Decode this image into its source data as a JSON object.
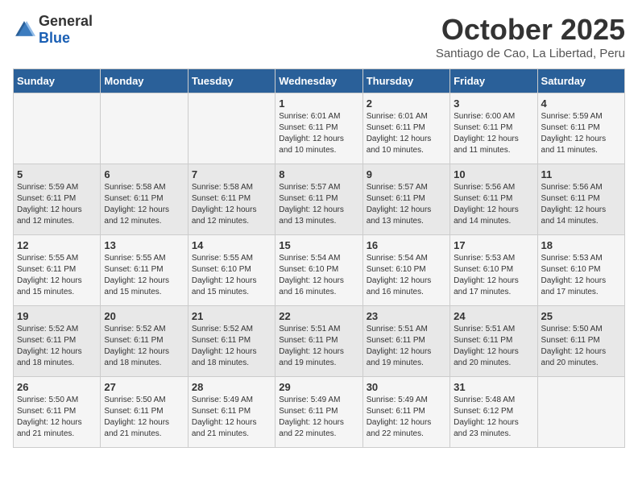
{
  "header": {
    "logo_general": "General",
    "logo_blue": "Blue",
    "month_title": "October 2025",
    "subtitle": "Santiago de Cao, La Libertad, Peru"
  },
  "weekdays": [
    "Sunday",
    "Monday",
    "Tuesday",
    "Wednesday",
    "Thursday",
    "Friday",
    "Saturday"
  ],
  "weeks": [
    [
      {
        "day": "",
        "sunrise": "",
        "sunset": "",
        "daylight": ""
      },
      {
        "day": "",
        "sunrise": "",
        "sunset": "",
        "daylight": ""
      },
      {
        "day": "",
        "sunrise": "",
        "sunset": "",
        "daylight": ""
      },
      {
        "day": "1",
        "sunrise": "Sunrise: 6:01 AM",
        "sunset": "Sunset: 6:11 PM",
        "daylight": "Daylight: 12 hours and 10 minutes."
      },
      {
        "day": "2",
        "sunrise": "Sunrise: 6:01 AM",
        "sunset": "Sunset: 6:11 PM",
        "daylight": "Daylight: 12 hours and 10 minutes."
      },
      {
        "day": "3",
        "sunrise": "Sunrise: 6:00 AM",
        "sunset": "Sunset: 6:11 PM",
        "daylight": "Daylight: 12 hours and 11 minutes."
      },
      {
        "day": "4",
        "sunrise": "Sunrise: 5:59 AM",
        "sunset": "Sunset: 6:11 PM",
        "daylight": "Daylight: 12 hours and 11 minutes."
      }
    ],
    [
      {
        "day": "5",
        "sunrise": "Sunrise: 5:59 AM",
        "sunset": "Sunset: 6:11 PM",
        "daylight": "Daylight: 12 hours and 12 minutes."
      },
      {
        "day": "6",
        "sunrise": "Sunrise: 5:58 AM",
        "sunset": "Sunset: 6:11 PM",
        "daylight": "Daylight: 12 hours and 12 minutes."
      },
      {
        "day": "7",
        "sunrise": "Sunrise: 5:58 AM",
        "sunset": "Sunset: 6:11 PM",
        "daylight": "Daylight: 12 hours and 12 minutes."
      },
      {
        "day": "8",
        "sunrise": "Sunrise: 5:57 AM",
        "sunset": "Sunset: 6:11 PM",
        "daylight": "Daylight: 12 hours and 13 minutes."
      },
      {
        "day": "9",
        "sunrise": "Sunrise: 5:57 AM",
        "sunset": "Sunset: 6:11 PM",
        "daylight": "Daylight: 12 hours and 13 minutes."
      },
      {
        "day": "10",
        "sunrise": "Sunrise: 5:56 AM",
        "sunset": "Sunset: 6:11 PM",
        "daylight": "Daylight: 12 hours and 14 minutes."
      },
      {
        "day": "11",
        "sunrise": "Sunrise: 5:56 AM",
        "sunset": "Sunset: 6:11 PM",
        "daylight": "Daylight: 12 hours and 14 minutes."
      }
    ],
    [
      {
        "day": "12",
        "sunrise": "Sunrise: 5:55 AM",
        "sunset": "Sunset: 6:11 PM",
        "daylight": "Daylight: 12 hours and 15 minutes."
      },
      {
        "day": "13",
        "sunrise": "Sunrise: 5:55 AM",
        "sunset": "Sunset: 6:11 PM",
        "daylight": "Daylight: 12 hours and 15 minutes."
      },
      {
        "day": "14",
        "sunrise": "Sunrise: 5:55 AM",
        "sunset": "Sunset: 6:10 PM",
        "daylight": "Daylight: 12 hours and 15 minutes."
      },
      {
        "day": "15",
        "sunrise": "Sunrise: 5:54 AM",
        "sunset": "Sunset: 6:10 PM",
        "daylight": "Daylight: 12 hours and 16 minutes."
      },
      {
        "day": "16",
        "sunrise": "Sunrise: 5:54 AM",
        "sunset": "Sunset: 6:10 PM",
        "daylight": "Daylight: 12 hours and 16 minutes."
      },
      {
        "day": "17",
        "sunrise": "Sunrise: 5:53 AM",
        "sunset": "Sunset: 6:10 PM",
        "daylight": "Daylight: 12 hours and 17 minutes."
      },
      {
        "day": "18",
        "sunrise": "Sunrise: 5:53 AM",
        "sunset": "Sunset: 6:10 PM",
        "daylight": "Daylight: 12 hours and 17 minutes."
      }
    ],
    [
      {
        "day": "19",
        "sunrise": "Sunrise: 5:52 AM",
        "sunset": "Sunset: 6:11 PM",
        "daylight": "Daylight: 12 hours and 18 minutes."
      },
      {
        "day": "20",
        "sunrise": "Sunrise: 5:52 AM",
        "sunset": "Sunset: 6:11 PM",
        "daylight": "Daylight: 12 hours and 18 minutes."
      },
      {
        "day": "21",
        "sunrise": "Sunrise: 5:52 AM",
        "sunset": "Sunset: 6:11 PM",
        "daylight": "Daylight: 12 hours and 18 minutes."
      },
      {
        "day": "22",
        "sunrise": "Sunrise: 5:51 AM",
        "sunset": "Sunset: 6:11 PM",
        "daylight": "Daylight: 12 hours and 19 minutes."
      },
      {
        "day": "23",
        "sunrise": "Sunrise: 5:51 AM",
        "sunset": "Sunset: 6:11 PM",
        "daylight": "Daylight: 12 hours and 19 minutes."
      },
      {
        "day": "24",
        "sunrise": "Sunrise: 5:51 AM",
        "sunset": "Sunset: 6:11 PM",
        "daylight": "Daylight: 12 hours and 20 minutes."
      },
      {
        "day": "25",
        "sunrise": "Sunrise: 5:50 AM",
        "sunset": "Sunset: 6:11 PM",
        "daylight": "Daylight: 12 hours and 20 minutes."
      }
    ],
    [
      {
        "day": "26",
        "sunrise": "Sunrise: 5:50 AM",
        "sunset": "Sunset: 6:11 PM",
        "daylight": "Daylight: 12 hours and 21 minutes."
      },
      {
        "day": "27",
        "sunrise": "Sunrise: 5:50 AM",
        "sunset": "Sunset: 6:11 PM",
        "daylight": "Daylight: 12 hours and 21 minutes."
      },
      {
        "day": "28",
        "sunrise": "Sunrise: 5:49 AM",
        "sunset": "Sunset: 6:11 PM",
        "daylight": "Daylight: 12 hours and 21 minutes."
      },
      {
        "day": "29",
        "sunrise": "Sunrise: 5:49 AM",
        "sunset": "Sunset: 6:11 PM",
        "daylight": "Daylight: 12 hours and 22 minutes."
      },
      {
        "day": "30",
        "sunrise": "Sunrise: 5:49 AM",
        "sunset": "Sunset: 6:11 PM",
        "daylight": "Daylight: 12 hours and 22 minutes."
      },
      {
        "day": "31",
        "sunrise": "Sunrise: 5:48 AM",
        "sunset": "Sunset: 6:12 PM",
        "daylight": "Daylight: 12 hours and 23 minutes."
      },
      {
        "day": "",
        "sunrise": "",
        "sunset": "",
        "daylight": ""
      }
    ]
  ]
}
